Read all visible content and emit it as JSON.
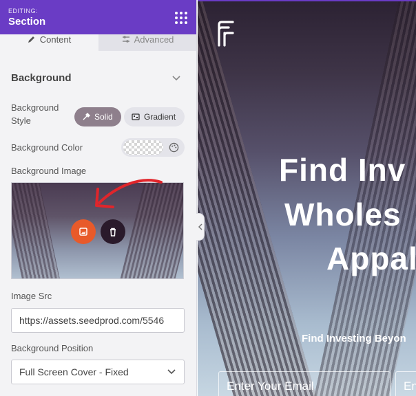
{
  "panel": {
    "editing_label": "EDITING:",
    "title": "Section",
    "tabs": [
      {
        "label": "Content",
        "icon": "pencil-icon"
      },
      {
        "label": "Advanced",
        "icon": "sliders-icon"
      }
    ],
    "section": {
      "title": "Background",
      "style_label_line1": "Background",
      "style_label_line2": "Style",
      "style_options": [
        {
          "label": "Solid",
          "icon": "eyedropper-icon",
          "active": true
        },
        {
          "label": "Gradient",
          "icon": "gradient-icon",
          "active": false
        }
      ],
      "color_label": "Background Color",
      "image_label": "Background Image",
      "image_src_label": "Image Src",
      "image_src_value": "https://assets.seedprod.com/5546",
      "position_label": "Background Position",
      "position_value": "Full Screen Cover - Fixed"
    }
  },
  "preview": {
    "headline_line1": "Find Inv",
    "headline_line2": "Wholes",
    "headline_line3": "Appal",
    "subheadline": "Find Investing Beyon",
    "email_placeholder": "Enter Your Email",
    "second_placeholder": "En"
  },
  "colors": {
    "accent": "#6a3cc5",
    "upload_button": "#e85a2a",
    "delete_button": "#2a1a2b",
    "solid_active": "#8e7f8c",
    "annotation_arrow": "#e0252b"
  }
}
